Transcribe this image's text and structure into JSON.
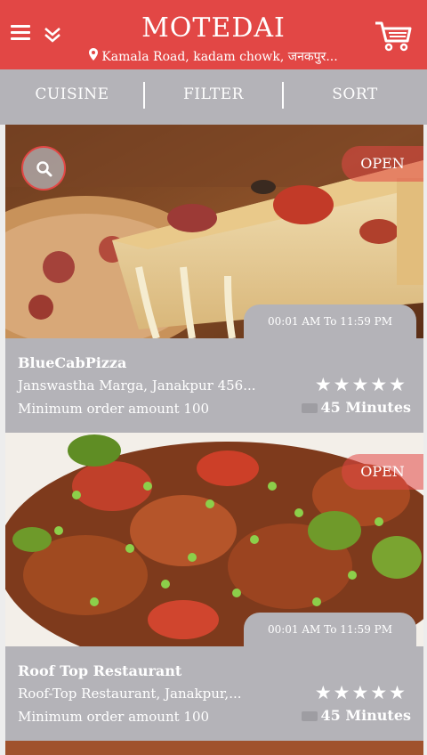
{
  "header": {
    "title": "MOTEDAI",
    "location": "Kamala Road, kadam chowk, जनकपुर...",
    "brand_color": "#e24745"
  },
  "icons": {
    "menu": "hamburger-menu-icon",
    "dropdown": "chevron-double-down-icon",
    "cart": "shopping-cart-icon",
    "location": "map-pin-icon",
    "search": "search-icon",
    "delivery": "delivery-truck-icon"
  },
  "tabs": [
    {
      "label": "CUISINE"
    },
    {
      "label": "FILTER"
    },
    {
      "label": "SORT"
    }
  ],
  "restaurants": [
    {
      "name": "BlueCabPizza",
      "status": "OPEN",
      "hours": "00:01 AM To 11:59 PM",
      "address": "Janswastha Marga, Janakpur 456...",
      "min_order": "Minimum order amount 100",
      "rating_stars": "★★★★★",
      "rating": 5,
      "delivery_time": "45 Minutes"
    },
    {
      "name": "Roof Top Restaurant",
      "status": "OPEN",
      "hours": "00:01 AM To 11:59 PM",
      "address": "Roof-Top Restaurant, Janakpur,...",
      "min_order": "Minimum order amount 100",
      "rating_stars": "★★★★★",
      "rating": 5,
      "delivery_time": "45 Minutes"
    }
  ]
}
